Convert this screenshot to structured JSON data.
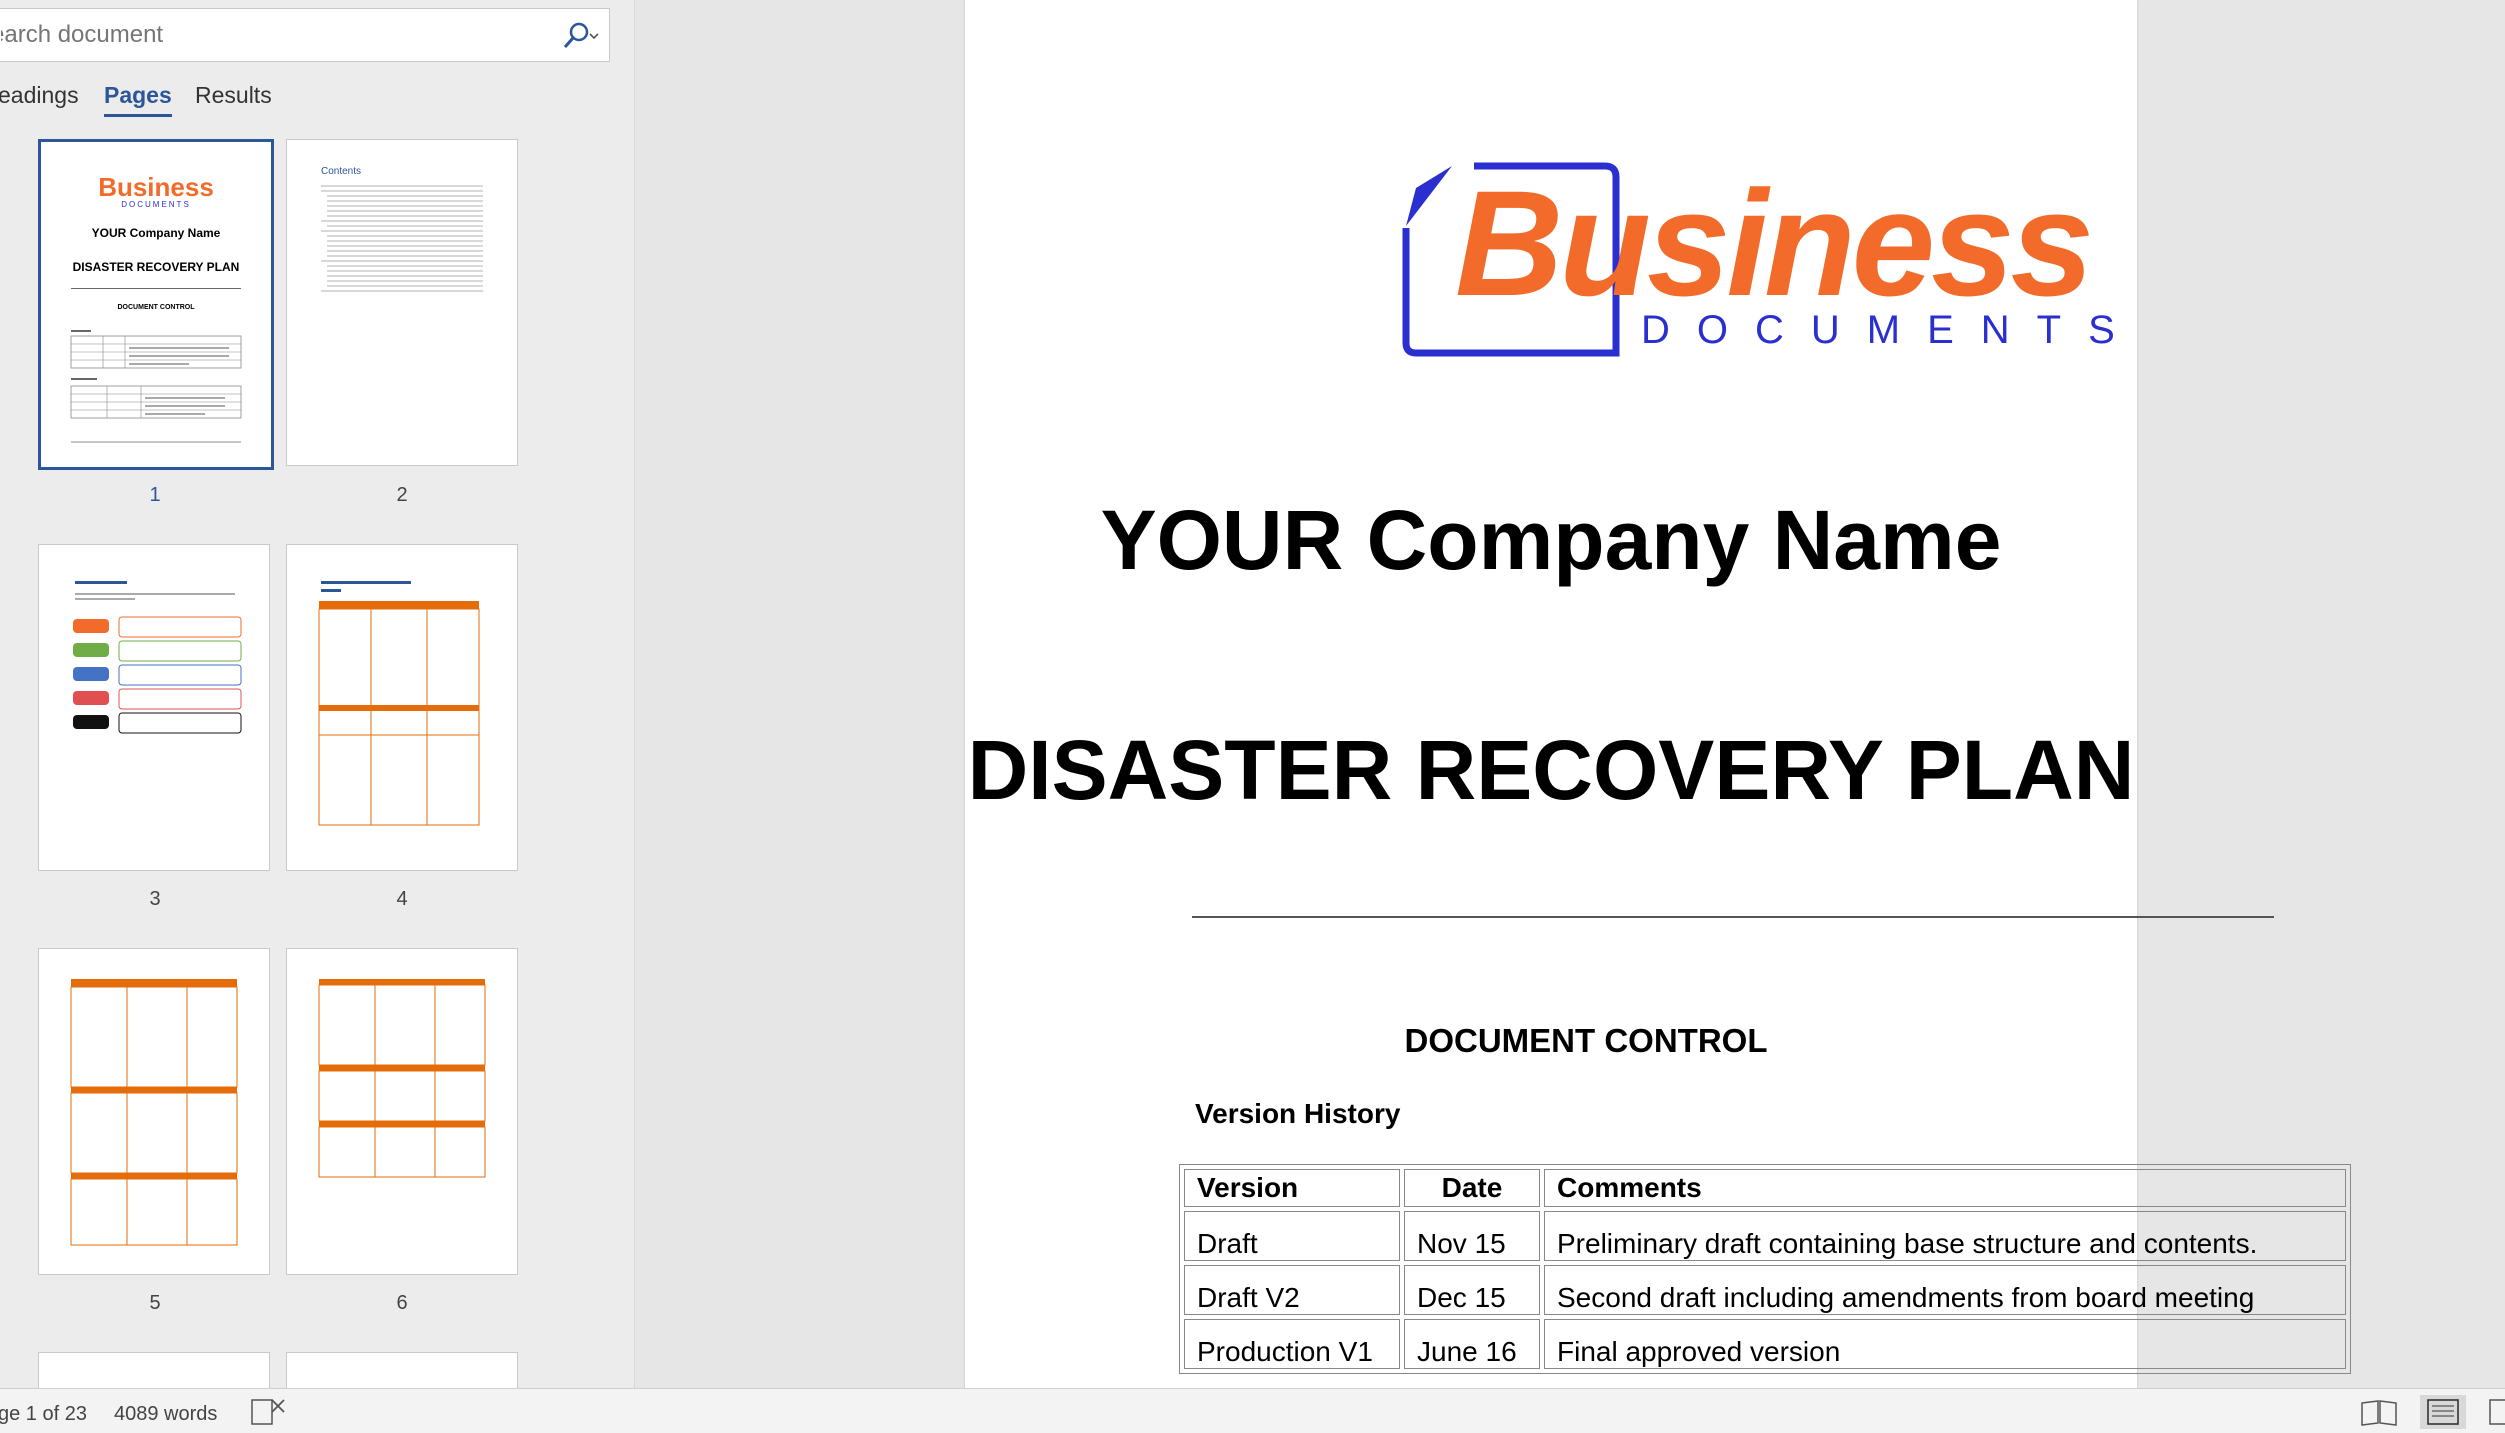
{
  "nav": {
    "search_placeholder": "earch document",
    "tabs": [
      {
        "label": "eadings"
      },
      {
        "label": "Pages",
        "active": true
      },
      {
        "label": "Results"
      }
    ],
    "page_numbers": [
      "1",
      "2",
      "3",
      "4",
      "5",
      "6"
    ],
    "selected_page": "1",
    "thumb1": {
      "logo": "Business",
      "logo_sub": "DOCUMENTS",
      "company": "YOUR Company Name",
      "title": "DISASTER RECOVERY PLAN",
      "control": "DOCUMENT CONTROL"
    },
    "thumb2": {
      "heading": "Contents"
    }
  },
  "document": {
    "logo_word": "Business",
    "logo_sub": "DOCUMENTS",
    "company_name": "YOUR Company Name",
    "plan_title": "DISASTER RECOVERY PLAN",
    "document_control": "DOCUMENT CONTROL",
    "version_history": "Version History",
    "table": {
      "headers": [
        "Version",
        "Date",
        "Comments"
      ],
      "rows": [
        [
          "Draft",
          "Nov 15",
          "Preliminary draft containing base structure and contents."
        ],
        [
          "Draft V2",
          "Dec 15",
          "Second draft including amendments from board meeting"
        ],
        [
          "Production V1",
          "June 16",
          "Final approved version"
        ]
      ]
    }
  },
  "status_bar": {
    "page_info": "ge 1 of 23",
    "word_count": "4089 words"
  },
  "colors": {
    "brand_orange": "#f26b2a",
    "brand_blue": "#2b2fd0",
    "accent": "#2b579a"
  }
}
